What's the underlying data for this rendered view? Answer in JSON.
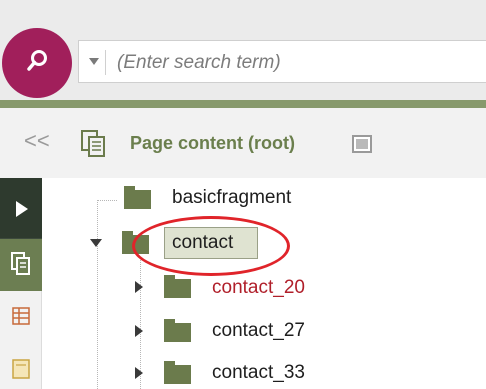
{
  "search": {
    "placeholder": "(Enter search term)"
  },
  "header": {
    "collapse_label": "<<",
    "title": "Page content (root)"
  },
  "tree": {
    "items": [
      {
        "label": "basicfragment",
        "expanded": null,
        "selected": false,
        "highlighted": false
      },
      {
        "label": "contact",
        "expanded": true,
        "selected": true,
        "highlighted": false
      },
      {
        "label": "contact_20",
        "expanded": false,
        "selected": false,
        "highlighted": true
      },
      {
        "label": "contact_27",
        "expanded": false,
        "selected": false,
        "highlighted": false
      },
      {
        "label": "contact_33",
        "expanded": false,
        "selected": false,
        "highlighted": false
      }
    ]
  },
  "colors": {
    "search_button": "#a11f5b",
    "accent": "#87996c",
    "title": "#6b7f4d",
    "folder": "#6b7b4c",
    "highlight_text": "#b01f2a",
    "annotation": "#e0242a"
  },
  "icons": {
    "search": "search-icon",
    "page_content": "page-copy-icon",
    "title_badge": "image-icon",
    "rail": [
      "play-icon",
      "pages-icon",
      "table-icon",
      "document-icon"
    ]
  }
}
